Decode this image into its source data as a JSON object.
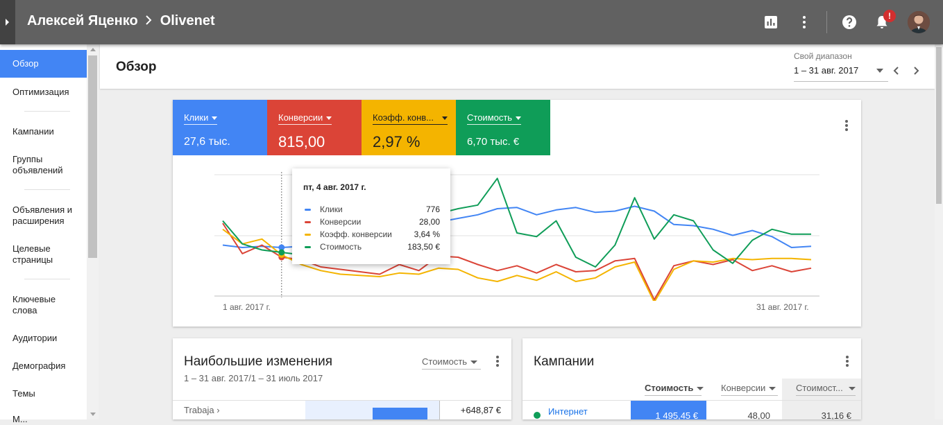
{
  "topbar": {
    "account": "Алексей Яценко",
    "subaccount": "Olivenet",
    "notification_badge": "!",
    "icons": [
      "chart-icon",
      "more-vert-icon",
      "help-icon",
      "bell-icon"
    ]
  },
  "sidebar": {
    "items": [
      {
        "label": "Обзор",
        "active": true
      },
      {
        "label": "Оптимизация"
      },
      {
        "label": "Кампании"
      },
      {
        "label": "Группы объявлений"
      },
      {
        "label": "Объявления и расширения"
      },
      {
        "label": "Целевые страницы"
      },
      {
        "label": "Ключевые слова"
      },
      {
        "label": "Аудитории"
      },
      {
        "label": "Демография"
      },
      {
        "label": "Темы"
      },
      {
        "label": "М..."
      }
    ]
  },
  "header": {
    "title": "Обзор",
    "range_label": "Свой диапазон",
    "range_value": "1 – 31 авг. 2017"
  },
  "metrics": [
    {
      "label": "Клики",
      "value": "27,6 тыс.",
      "color": "#4285f4"
    },
    {
      "label": "Конверсии",
      "value": "815,00",
      "color": "#db4437"
    },
    {
      "label": "Коэфф. конв...",
      "value": "2,97 %",
      "color": "#f4b400"
    },
    {
      "label": "Стоимость",
      "value": "6,70 тыс. €",
      "color": "#0f9d58"
    }
  ],
  "chart_data": {
    "type": "line",
    "x_start_label": "1 авг. 2017 г.",
    "x_end_label": "31 авг. 2017 г.",
    "x": [
      1,
      2,
      3,
      4,
      5,
      6,
      7,
      8,
      9,
      10,
      11,
      12,
      13,
      14,
      15,
      16,
      17,
      18,
      19,
      20,
      21,
      22,
      23,
      24,
      25,
      26,
      27,
      28,
      29,
      30,
      31
    ],
    "series": [
      {
        "name": "Клики",
        "color": "#4285f4",
        "values": [
          0.42,
          0.4,
          0.41,
          0.4,
          0.41,
          0.44,
          0.47,
          0.5,
          0.52,
          0.55,
          0.58,
          0.61,
          0.64,
          0.67,
          0.72,
          0.73,
          0.67,
          0.71,
          0.73,
          0.69,
          0.7,
          0.74,
          0.7,
          0.59,
          0.58,
          0.55,
          0.5,
          0.54,
          0.49,
          0.4,
          0.41
        ]
      },
      {
        "name": "Конверсии",
        "color": "#db4437",
        "values": [
          0.6,
          0.35,
          0.42,
          0.32,
          0.3,
          0.24,
          0.22,
          0.2,
          0.18,
          0.26,
          0.21,
          0.33,
          0.32,
          0.26,
          0.21,
          0.25,
          0.19,
          0.26,
          0.2,
          0.21,
          0.29,
          0.31,
          -0.03,
          0.25,
          0.29,
          0.26,
          0.3,
          0.21,
          0.25,
          0.2,
          0.23
        ]
      },
      {
        "name": "Коэфф. конверсии",
        "color": "#f4b400",
        "values": [
          0.55,
          0.43,
          0.47,
          0.34,
          0.26,
          0.21,
          0.18,
          0.17,
          0.16,
          0.19,
          0.18,
          0.23,
          0.22,
          0.15,
          0.12,
          0.17,
          0.13,
          0.2,
          0.12,
          0.15,
          0.24,
          0.28,
          -0.05,
          0.22,
          0.29,
          0.28,
          0.31,
          0.3,
          0.31,
          0.31,
          0.3
        ]
      },
      {
        "name": "Стоимость",
        "color": "#0f9d58",
        "values": [
          0.62,
          0.43,
          0.38,
          0.36,
          0.34,
          0.35,
          0.38,
          0.45,
          0.52,
          0.58,
          0.65,
          0.68,
          0.72,
          0.75,
          0.97,
          0.52,
          0.49,
          0.62,
          0.32,
          0.24,
          0.42,
          0.81,
          0.47,
          0.67,
          0.62,
          0.38,
          0.27,
          0.46,
          0.55,
          0.51,
          0.51
        ]
      }
    ],
    "tooltip": {
      "date": "пт, 4 авг. 2017 г.",
      "rows": [
        {
          "name": "Клики",
          "value": "776",
          "color": "#4285f4"
        },
        {
          "name": "Конверсии",
          "value": "28,00",
          "color": "#db4437"
        },
        {
          "name": "Коэфф. конверсии",
          "value": "3,64 %",
          "color": "#f4b400"
        },
        {
          "name": "Стоимость",
          "value": "183,50 €",
          "color": "#0f9d58"
        }
      ]
    }
  },
  "changes_card": {
    "title": "Наибольшие изменения",
    "subtitle": "1 – 31 авг. 2017/1 – 31 июль 2017",
    "metric_select": "Стоимость",
    "row_label": "Trabaja ›",
    "row_value": "+648,87 €"
  },
  "campaigns_card": {
    "title": "Кампании",
    "columns": [
      "Стоимость",
      "Конверсии",
      "Стоимост..."
    ],
    "rows": [
      {
        "name": "Интернет",
        "cost": "1 495,45 €",
        "conv": "48,00",
        "cost2": "31,16 €"
      }
    ]
  }
}
